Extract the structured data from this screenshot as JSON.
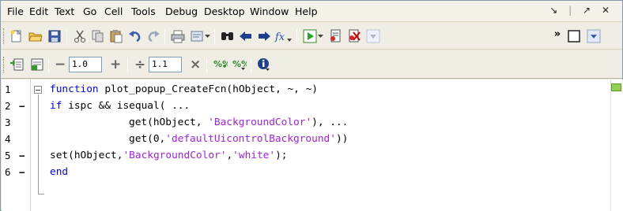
{
  "menu": {
    "items": [
      "File",
      "Edit",
      "Text",
      "Go",
      "Cell",
      "Tools",
      "Debug",
      "Desktop",
      "Window",
      "Help"
    ]
  },
  "window_controls": {
    "undock": "↘",
    "maximize": "↗",
    "close": "✕"
  },
  "cell_toolbar": {
    "minus_label": "−",
    "plus_label": "+",
    "divide_label": "÷",
    "times_label": "×",
    "decrement_value": "1.0",
    "multiply_value": "1.1"
  },
  "editor": {
    "lines": [
      {
        "num": "1",
        "dash": ""
      },
      {
        "num": "2",
        "dash": "−"
      },
      {
        "num": "3",
        "dash": ""
      },
      {
        "num": "4",
        "dash": ""
      },
      {
        "num": "5",
        "dash": "−"
      },
      {
        "num": "6",
        "dash": "−"
      }
    ],
    "code": {
      "l1_kw": "function",
      "l1_rest": " plot_popup_CreateFcn(hObject, ~, ~)",
      "l2_kw": "if",
      "l2_rest": " ispc && isequal( ...",
      "l3_pre": "get(hObject, ",
      "l3_str": "'BackgroundColor'",
      "l3_post": "), ...",
      "l4_pre": "get(0,",
      "l4_str": "'defaultUicontrolBackground'",
      "l4_post": "))",
      "l5_pre": "set(hObject,",
      "l5_str1": "'BackgroundColor'",
      "l5_mid": ",",
      "l5_str2": "'white'",
      "l5_post": ");",
      "l6_kw": "end"
    }
  },
  "colors": {
    "keyword": "#0000ff",
    "string": "#a020f0",
    "status_ok": "#92d050"
  }
}
